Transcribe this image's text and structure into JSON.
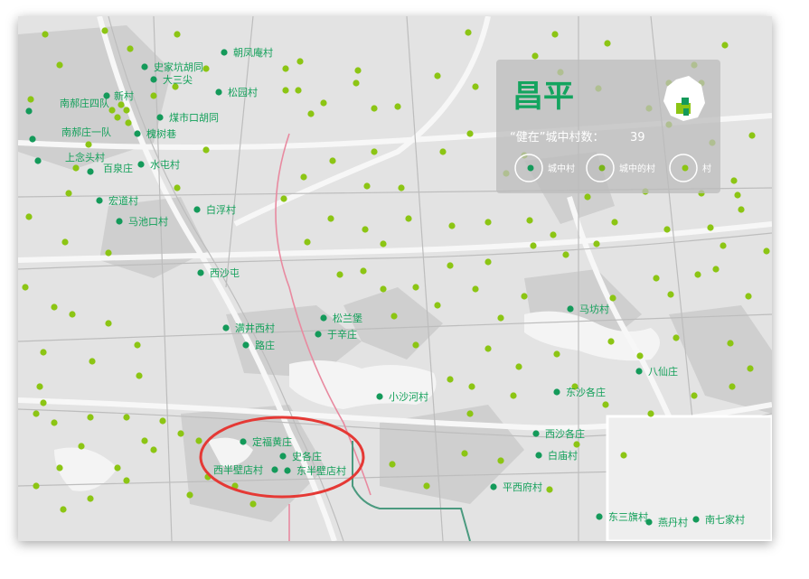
{
  "district_title": "昌平",
  "village_count_label": "“健在”城中村数：",
  "village_count_value": "39",
  "legend": [
    {
      "label": "城中村",
      "icon": "urban-village-dot"
    },
    {
      "label": "城中的村",
      "icon": "village-in-city-dot"
    },
    {
      "label": "村",
      "icon": "village-dot"
    }
  ],
  "colors": {
    "urban_village": "#149a5a",
    "village": "#8cc514",
    "highlight_circle": "#e53935",
    "rail_line": "#e88aa0",
    "metro_line": "#4b9a7f"
  },
  "labels": [
    "朝凤庵村",
    "史家坑胡同",
    "大三尖",
    "松园村",
    "新村",
    "南郝庄四队",
    "煤市口胡同",
    "槐树巷",
    "南郝庄一队",
    "上念头村",
    "水屯村",
    "百泉庄",
    "宏道村",
    "白浮村",
    "马池口村",
    "西沙屯",
    "满井西村",
    "松兰堡",
    "于辛庄",
    "路庄",
    "马坊村",
    "八仙庄",
    "小沙河村",
    "东沙各庄",
    "西沙各庄",
    "定福黄庄",
    "史各庄",
    "白庙村",
    "西半壁店村",
    "东半壁店村",
    "平西府村",
    "东三旗村",
    "燕丹村",
    "南七家村"
  ]
}
